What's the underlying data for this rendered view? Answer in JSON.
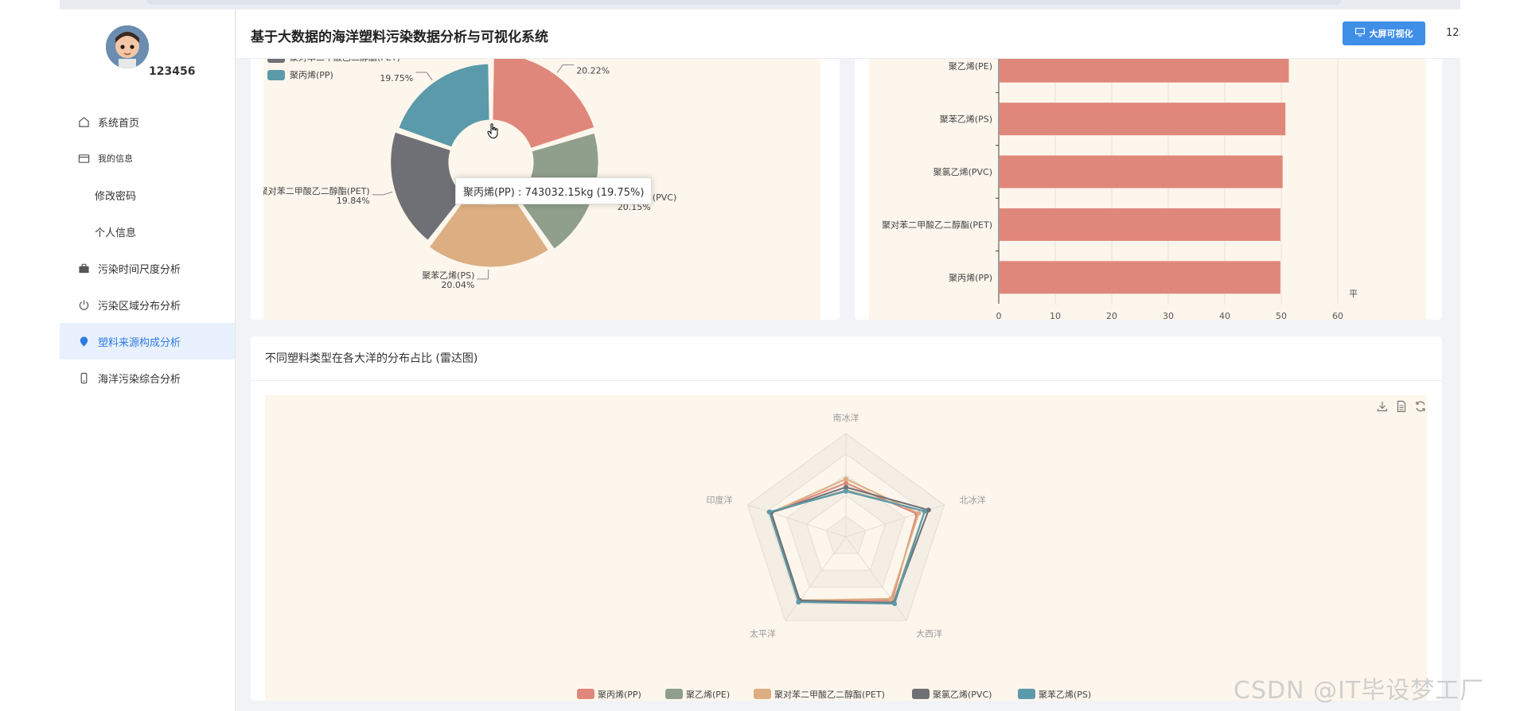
{
  "app": {
    "title": "基于大数据的海洋塑料污染数据分析与可视化系统",
    "bigscreen_label": "大屏可视化",
    "user_menu": "123456"
  },
  "sidebar": {
    "username": "123456",
    "items": [
      {
        "label": "系统首页",
        "icon": "home-icon"
      },
      {
        "label": "我的信息",
        "icon": "card-icon"
      },
      {
        "label": "修改密码",
        "icon": ""
      },
      {
        "label": "个人信息",
        "icon": ""
      },
      {
        "label": "污染时间尺度分析",
        "icon": "briefcase-icon"
      },
      {
        "label": "污染区域分布分析",
        "icon": "power-icon"
      },
      {
        "label": "塑料来源构成分析",
        "icon": "location-icon"
      },
      {
        "label": "海洋污染综合分析",
        "icon": "phone-icon"
      }
    ],
    "active_index": 6
  },
  "colors": {
    "accent": "#3f8ee7",
    "pp": "#e0877b",
    "pe": "#909e8c",
    "pet": "#dcae82",
    "pvc": "#6f7075",
    "ps": "#5a9aaa",
    "chart_bg": "#fdf6ec"
  },
  "tooltip": "聚丙烯(PP) : 743032.15kg (19.75%)",
  "watermark": "CSDN @IT毕设梦工厂",
  "charts": {
    "radar_title": "不同塑料类型在各大洋的分布占比 (雷达图)"
  },
  "chart_data": [
    {
      "type": "pie",
      "legend": [
        "聚苯乙烯(PS)",
        "聚对苯二甲酸乙二醇酯(PET)",
        "聚丙烯(PP)"
      ],
      "slices": [
        {
          "name": "",
          "value": 20.22,
          "pct_label": "20.22%",
          "color": "#e0877b"
        },
        {
          "name": "聚氯乙烯(PVC)",
          "value": 20.15,
          "pct_label": "20.15%",
          "color": "#909e8c"
        },
        {
          "name": "聚苯乙烯(PS)",
          "value": 20.04,
          "pct_label": "20.04%",
          "color": "#dcae82"
        },
        {
          "name": "聚对苯二甲酸乙二醇酯(PET)",
          "value": 19.84,
          "pct_label": "19.84%",
          "color": "#6f7075"
        },
        {
          "name": "",
          "value": 19.75,
          "pct_label": "19.75%",
          "color": "#5a9aaa"
        }
      ]
    },
    {
      "type": "bar",
      "orientation": "horizontal",
      "categories": [
        "聚乙烯(PE)",
        "聚苯乙烯(PS)",
        "聚氯乙烯(PVC)",
        "聚对苯二甲酸乙二醇酯(PET)",
        "聚丙烯(PP)"
      ],
      "values": [
        51.2,
        50.6,
        50.1,
        49.7,
        49.7
      ],
      "xlim": [
        0,
        60
      ],
      "xticks": [
        "0",
        "10",
        "20",
        "30",
        "40",
        "50",
        "60"
      ],
      "xlabel": "平",
      "color": "#e0877b"
    },
    {
      "type": "radar",
      "title": "不同塑料类型在各大洋的分布占比 (雷达图)",
      "indicators": [
        "南冰洋",
        "北冰洋",
        "大西洋",
        "太平洋",
        "印度洋"
      ],
      "series": [
        {
          "name": "聚丙烯(PP)",
          "color": "#e0877b",
          "values": [
            0.52,
            0.72,
            0.76,
            0.76,
            0.76
          ]
        },
        {
          "name": "聚乙烯(PE)",
          "color": "#909e8c",
          "values": [
            0.45,
            0.8,
            0.78,
            0.78,
            0.76
          ]
        },
        {
          "name": "聚对苯二甲酸乙二醇酯(PET)",
          "color": "#dcae82",
          "values": [
            0.56,
            0.74,
            0.74,
            0.76,
            0.76
          ]
        },
        {
          "name": "聚氯乙烯(PVC)",
          "color": "#6f7075",
          "values": [
            0.48,
            0.84,
            0.79,
            0.76,
            0.76
          ]
        },
        {
          "name": "聚苯乙烯(PS)",
          "color": "#5a9aaa",
          "values": [
            0.44,
            0.8,
            0.8,
            0.78,
            0.78
          ]
        }
      ]
    }
  ]
}
